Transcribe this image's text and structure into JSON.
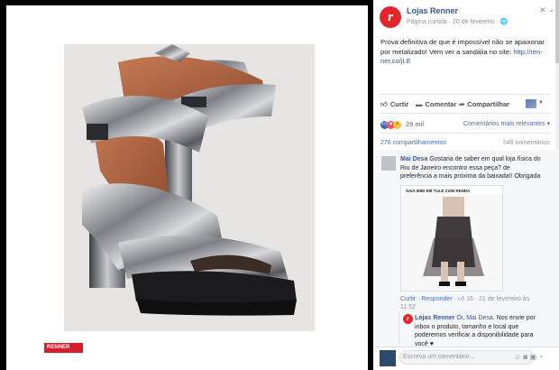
{
  "photo": {
    "watermark": "RENNER"
  },
  "post": {
    "page_name": "Lojas Renner",
    "meta": "Página curtida · 20 de fevereiro · 🌐",
    "text": "Prova definitiva de que é impossível não se apaixonar por metalizado! Vem ver a sandália no site: ",
    "link": "http://ren-ner.co/jLE"
  },
  "actions": {
    "like": "Curtir",
    "comment": "Comentar",
    "share": "Compartilhar"
  },
  "stats": {
    "reactions_count": "29 mil",
    "sort": "Comentários mais relevantes ▾",
    "shares": "276 compartilhamentos",
    "comments": "546 comentários"
  },
  "comment": {
    "author": "Mai Desa",
    "text": " Gostaria de saber em qual loja física do Rio de Janeiro encontro essa peça? de preferência a mais próxima da baixada!! Obrigada",
    "image_title": "SAIA MIDI EM TULE COM RENDA",
    "like": "Curtir",
    "reply": "Responder",
    "like_count": "16",
    "date": "21 de fevereiro às 11:52"
  },
  "reply": {
    "author": "Lojas Renner",
    "mention": "Oi, Mai Desa.",
    "text": " Nos envie por inbox o produto, tamanho e local que poderemos verificar a disponibilidade para você ♥"
  },
  "composer": {
    "placeholder": "Escreva um comentário..."
  },
  "colors": {
    "brand_red": "#d21f2b",
    "link_blue": "#365899"
  }
}
